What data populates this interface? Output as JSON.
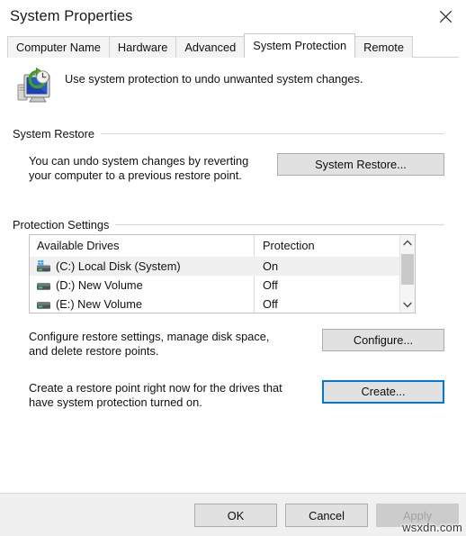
{
  "window": {
    "title": "System Properties",
    "close_icon": "close-icon"
  },
  "tabs": [
    {
      "label": "Computer Name",
      "active": false
    },
    {
      "label": "Hardware",
      "active": false
    },
    {
      "label": "Advanced",
      "active": false
    },
    {
      "label": "System Protection",
      "active": true
    },
    {
      "label": "Remote",
      "active": false
    }
  ],
  "banner": {
    "icon": "system-protection-icon",
    "text": "Use system protection to undo unwanted system changes."
  },
  "system_restore": {
    "group_title": "System Restore",
    "description": "You can undo system changes by reverting\nyour computer to a previous restore point.",
    "button_label": "System Restore..."
  },
  "protection_settings": {
    "group_title": "Protection Settings",
    "columns": [
      "Available Drives",
      "Protection"
    ],
    "drives": [
      {
        "name": "(C:) Local Disk (System)",
        "protection": "On",
        "icon": "system-drive-icon",
        "selected": true
      },
      {
        "name": "(D:) New Volume",
        "protection": "Off",
        "icon": "drive-icon",
        "selected": false
      },
      {
        "name": "(E:) New Volume",
        "protection": "Off",
        "icon": "drive-icon",
        "selected": false
      }
    ],
    "scrollbar": {
      "up_icon": "chevron-up-icon",
      "down_icon": "chevron-down-icon"
    },
    "configure": {
      "description": "Configure restore settings, manage disk space,\nand delete restore points.",
      "button_label": "Configure..."
    },
    "create": {
      "description": "Create a restore point right now for the drives that\nhave system protection turned on.",
      "button_label": "Create..."
    }
  },
  "footer": {
    "ok_label": "OK",
    "cancel_label": "Cancel",
    "apply_label": "Apply",
    "apply_disabled": true
  },
  "watermark": {
    "text": "wsxdn.com"
  },
  "colors": {
    "accent": "#0078d7",
    "button_face": "#e1e1e1",
    "footer_bg": "#f0f0f0",
    "selection": "#f0f0f0"
  }
}
